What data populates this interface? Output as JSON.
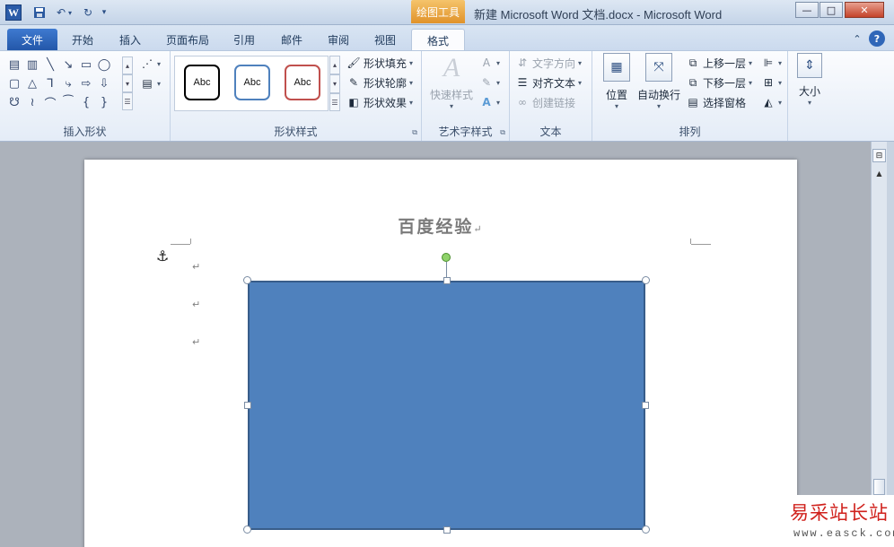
{
  "window": {
    "app_icon": "W",
    "context_tab": "绘图工具",
    "title": "新建 Microsoft Word 文档.docx - Microsoft Word",
    "controls": {
      "minimize": "—",
      "maximize": "□",
      "close": "✕"
    }
  },
  "qat": {
    "save_icon": "floppy-icon",
    "undo_icon": "undo-icon",
    "redo_icon": "redo-icon"
  },
  "tabs": [
    {
      "label": "文件"
    },
    {
      "label": "开始"
    },
    {
      "label": "插入"
    },
    {
      "label": "页面布局"
    },
    {
      "label": "引用"
    },
    {
      "label": "邮件"
    },
    {
      "label": "审阅"
    },
    {
      "label": "视图"
    },
    {
      "label": "格式"
    }
  ],
  "ribbon": {
    "insert_shapes": {
      "label": "插入形状"
    },
    "shape_styles": {
      "label": "形状样式",
      "samples": [
        "Abc",
        "Abc",
        "Abc"
      ],
      "fill": "形状填充",
      "outline": "形状轮廓",
      "effects": "形状效果"
    },
    "wordart": {
      "label": "艺术字样式",
      "quick_styles": "快速样式",
      "letter": "A"
    },
    "text": {
      "label": "文本",
      "direction": "文字方向",
      "align": "对齐文本",
      "link": "创建链接"
    },
    "arrange": {
      "label": "排列",
      "position": "位置",
      "wrap": "自动换行",
      "bring_forward": "上移一层",
      "send_backward": "下移一层",
      "selection_pane": "选择窗格"
    },
    "size": {
      "label": "大小"
    }
  },
  "document": {
    "heading": "百度经验",
    "para_mark": "↵"
  },
  "shape": {
    "fill_color": "#4f81bd",
    "outline_color": "#385d8a"
  },
  "watermark": {
    "main": "易采站长站",
    "sub": "www.easck.com"
  }
}
